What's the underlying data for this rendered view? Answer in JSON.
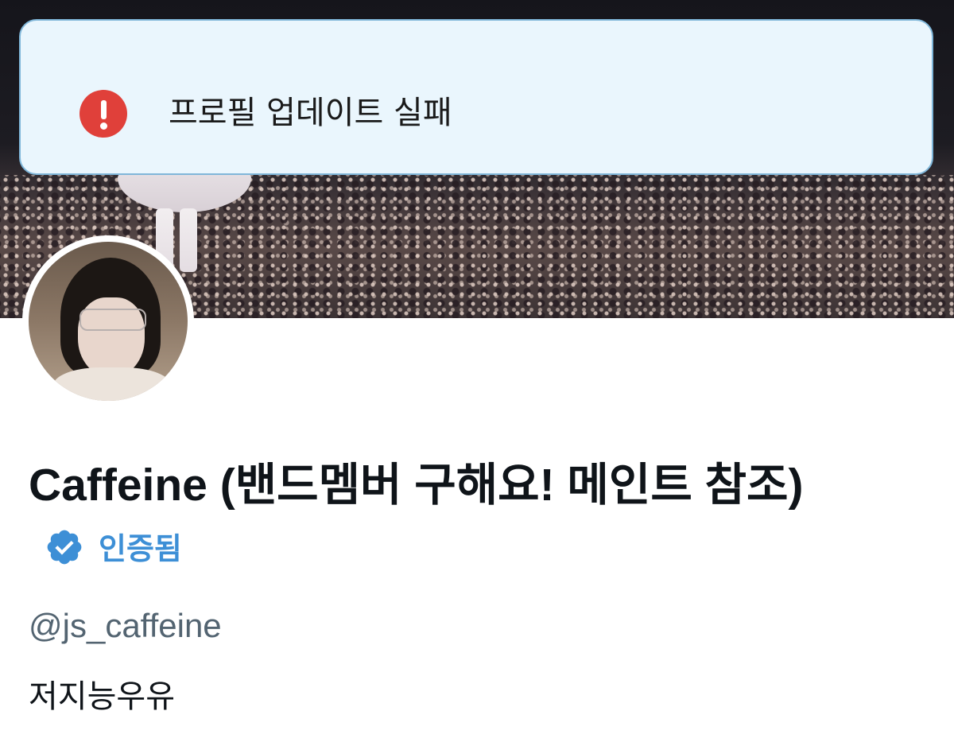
{
  "toast": {
    "icon": "error-icon",
    "message": "프로필 업데이트 실패",
    "icon_color": "#e0403a",
    "background": "#eaf6fd"
  },
  "profile": {
    "display_name": "Caffeine (밴드멤버 구해요! 메인트 참조)",
    "verified_icon": "verified-badge-icon",
    "verified_label": "인증됨",
    "handle": "@js_caffeine",
    "bio": "저지능우유",
    "accent_color": "#3d8fd6"
  }
}
